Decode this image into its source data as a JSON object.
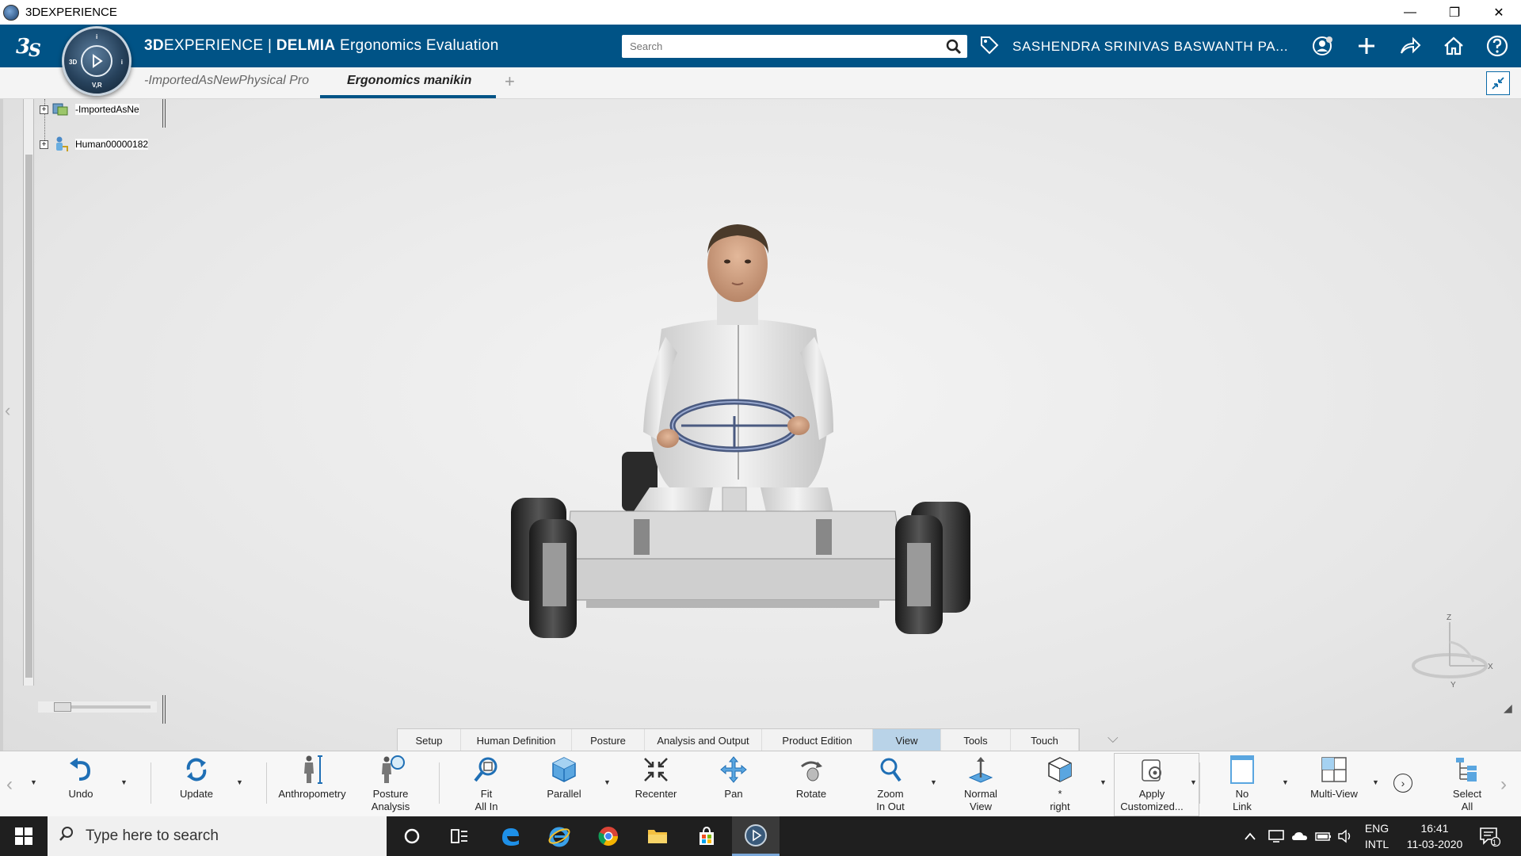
{
  "window": {
    "title": "3DEXPERIENCE",
    "minimize": "—",
    "restore": "❐",
    "close": "✕"
  },
  "header": {
    "brand_prefix": "3D",
    "brand_rest": "EXPERIENCE | ",
    "brand_app": "DELMIA",
    "brand_module": " Ergonomics Evaluation",
    "search_placeholder": "Search",
    "user_name": "SASHENDRA SRINIVAS BASWANTH PA...",
    "compass_labels": {
      "top": "i",
      "left": "3D",
      "right": "i",
      "bottom": "V,R"
    }
  },
  "tabs": [
    {
      "label": "-ImportedAsNewPhysical Pro",
      "active": false
    },
    {
      "label": "Ergonomics manikin",
      "active": true
    }
  ],
  "tree": {
    "nodes": [
      {
        "label": "-ImportedAsNe"
      },
      {
        "label": "Human00000182"
      }
    ]
  },
  "axis_labels": {
    "z": "Z",
    "x": "X",
    "y": "Y"
  },
  "section_tabs": [
    {
      "label": "Setup",
      "active": false
    },
    {
      "label": "Human Definition",
      "active": false
    },
    {
      "label": "Posture",
      "active": false
    },
    {
      "label": "Analysis and Output",
      "active": false
    },
    {
      "label": "Product Edition",
      "active": false
    },
    {
      "label": "View",
      "active": true
    },
    {
      "label": "Tools",
      "active": false
    },
    {
      "label": "Touch",
      "active": false
    }
  ],
  "actionbar": {
    "undo": "Undo",
    "update": "Update",
    "anthropometry": "Anthropometry",
    "posture_analysis": "Posture\nAnalysis",
    "fit_all_in": "Fit\nAll In",
    "parallel": "Parallel",
    "recenter": "Recenter",
    "pan": "Pan",
    "rotate": "Rotate",
    "zoom_in_out": "Zoom\nIn Out",
    "normal_view": "Normal\nView",
    "right": "*\nright",
    "apply_customized": "Apply\nCustomized...",
    "no_link": "No\nLink",
    "multi_view": "Multi-View",
    "select_all": "Select\nAll"
  },
  "taskbar": {
    "search_placeholder": "Type here to search",
    "lang_1": "ENG",
    "lang_2": "INTL",
    "time": "16:41",
    "date": "11-03-2020",
    "notification_count": "1"
  },
  "colors": {
    "header_bg": "#005386",
    "active_section_tab": "#b9d3e8",
    "taskbar_bg": "#1f1f1f"
  }
}
